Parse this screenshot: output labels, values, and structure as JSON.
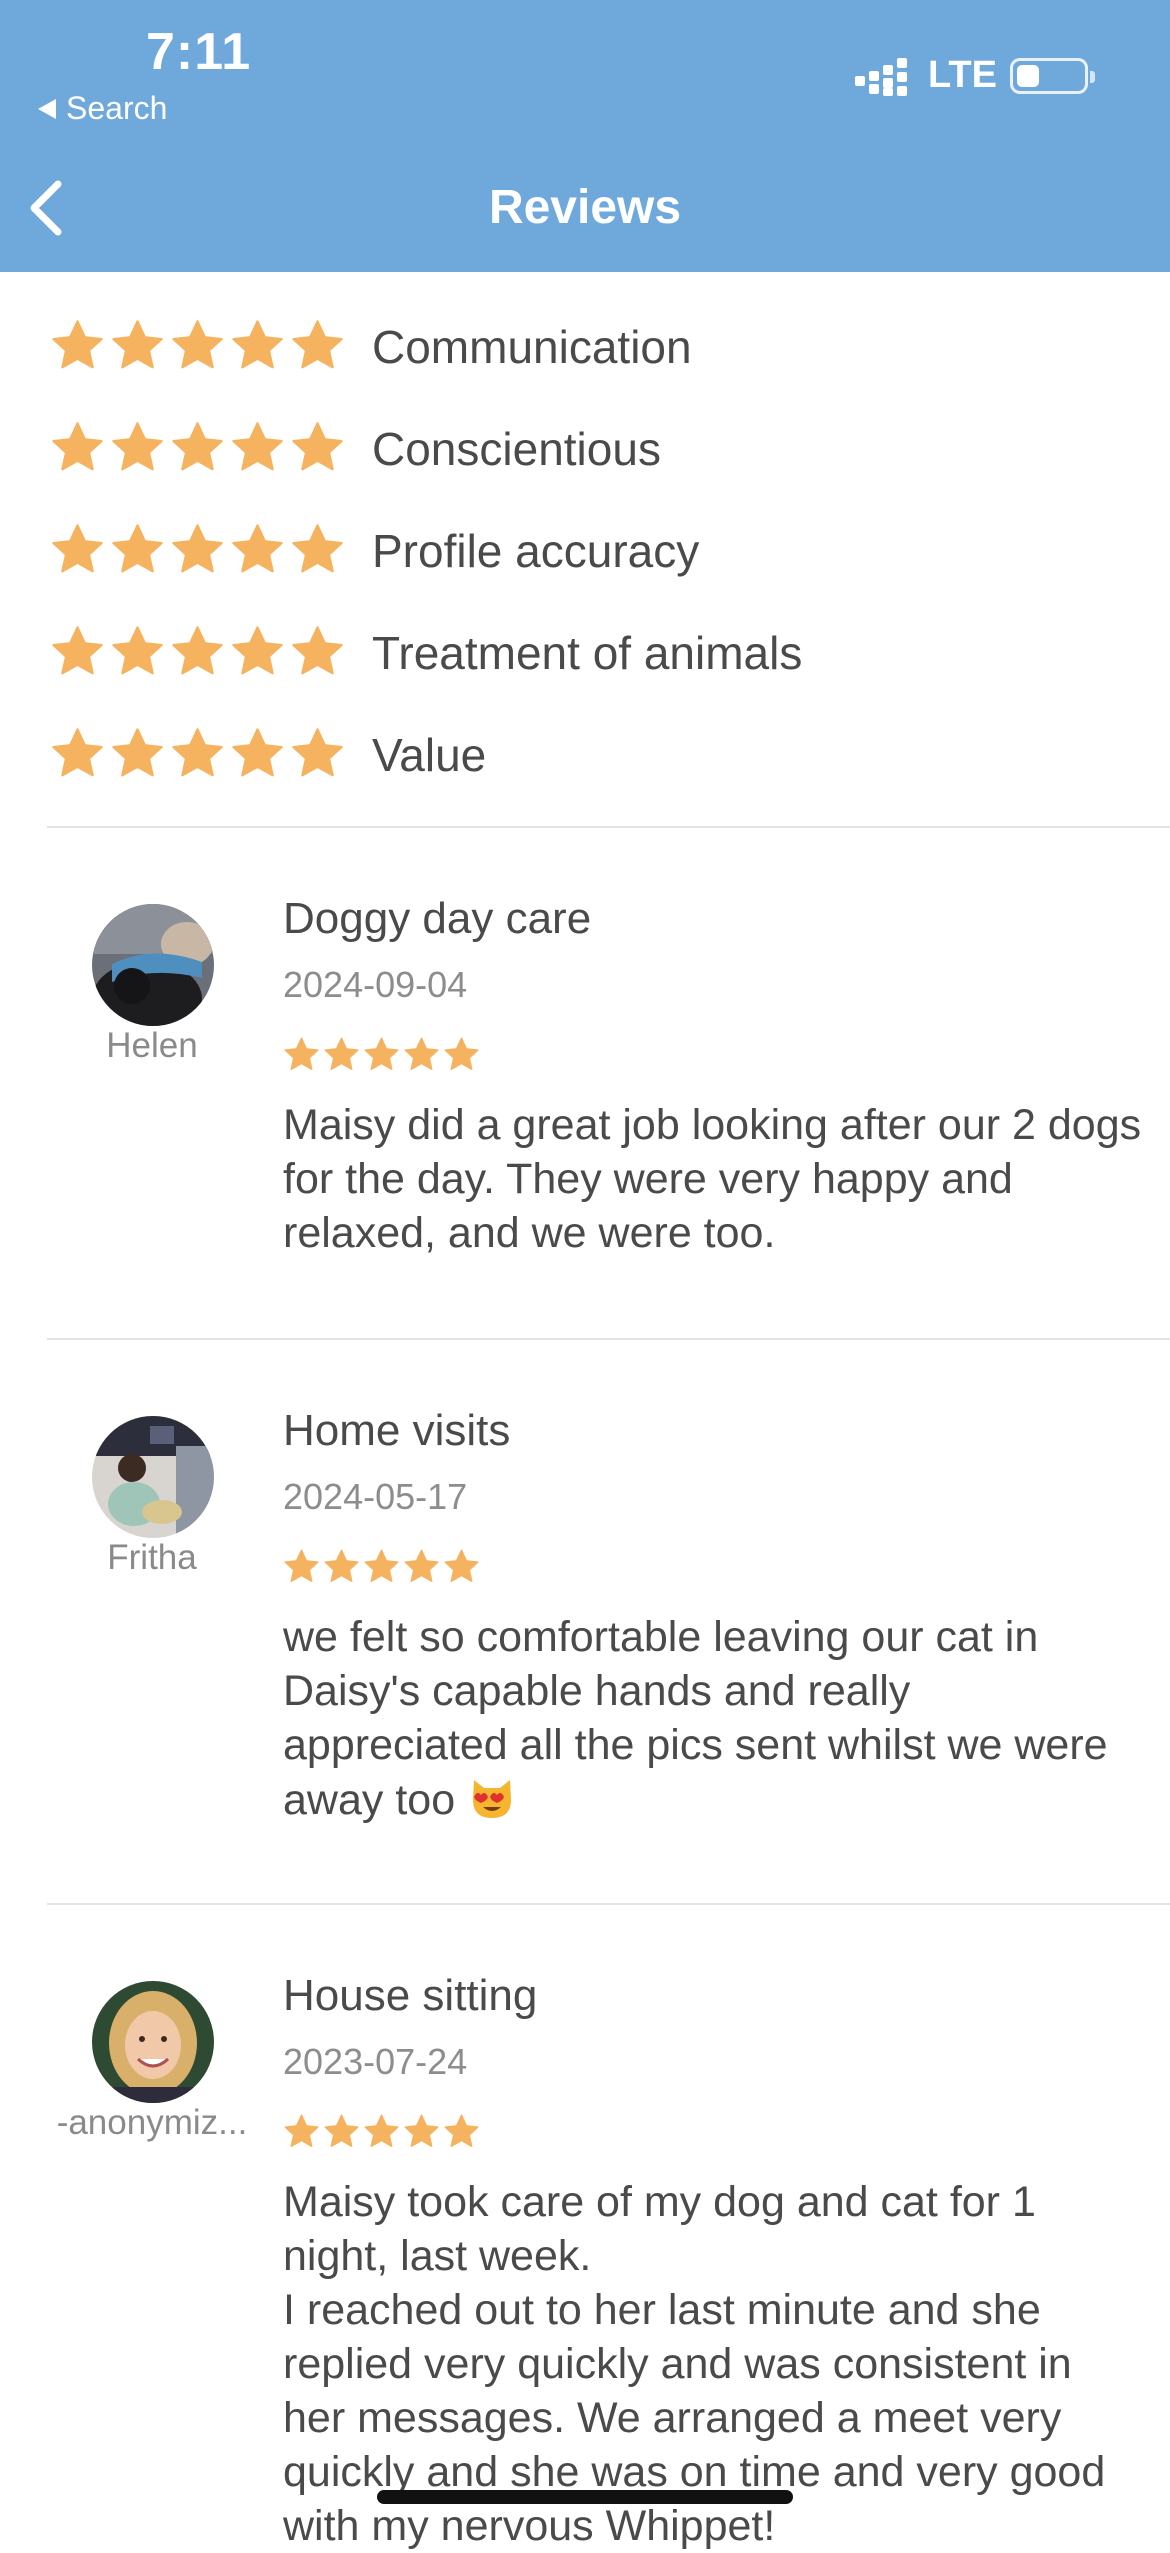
{
  "status_bar": {
    "time": "7:11",
    "back_label": "Search",
    "network": "LTE",
    "battery_level": 0.3
  },
  "nav": {
    "title": "Reviews"
  },
  "colors": {
    "header": "#6fa8db",
    "star": "#f5b35f",
    "text": "#4a4a4a",
    "muted": "#8d8d8d"
  },
  "ratings": [
    {
      "label": "Communication",
      "stars": 5
    },
    {
      "label": "Conscientious",
      "stars": 5
    },
    {
      "label": "Profile accuracy",
      "stars": 5
    },
    {
      "label": "Treatment of animals",
      "stars": 5
    },
    {
      "label": "Value",
      "stars": 5
    }
  ],
  "reviews": [
    {
      "reviewer": "Helen",
      "service": "Doggy day care",
      "date": "2024-09-04",
      "stars": 5,
      "text": "Maisy did a great job looking after our 2 dogs for the day. They were very happy and relaxed, and we were too."
    },
    {
      "reviewer": "Fritha",
      "service": "Home visits",
      "date": "2024-05-17",
      "stars": 5,
      "text": "we felt so comfortable leaving our cat in Daisy's capable hands and really appreciated all the pics sent whilst we were away too",
      "emoji": "smiling-cat-heart-eyes-icon"
    },
    {
      "reviewer": "-anonymiz...",
      "service": "House sitting",
      "date": "2023-07-24",
      "stars": 5,
      "text_lines": [
        "Maisy took care of my dog and cat for 1 night, last week.",
        "I reached out to her last minute and she replied very quickly and was consistent in her messages. We arranged a meet very quickly and she was on time and very good with my nervous Whippet!"
      ]
    }
  ]
}
